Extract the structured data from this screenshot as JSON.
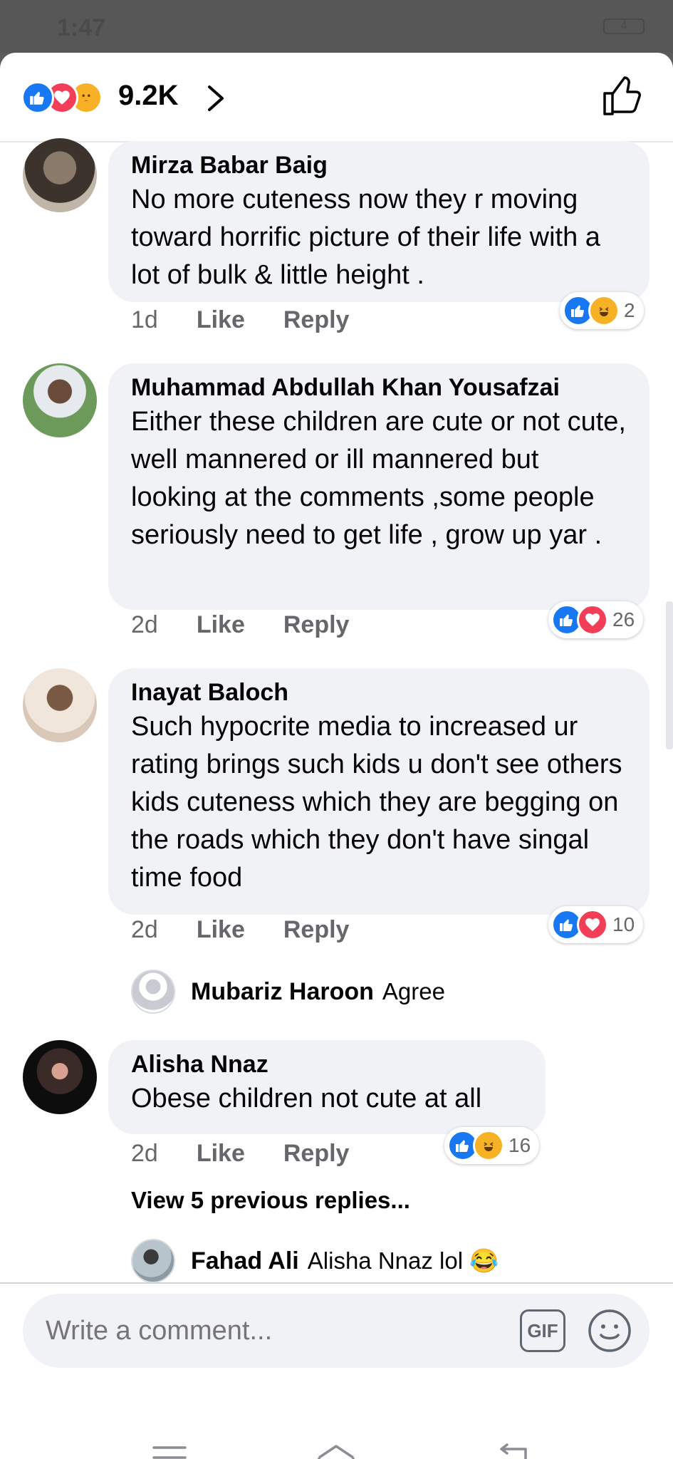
{
  "status_bar": {
    "time": "1:47",
    "battery": "4"
  },
  "header": {
    "reaction_count": "9.2K",
    "reactions": [
      "like-icon",
      "love-icon",
      "care-icon"
    ]
  },
  "comments": [
    {
      "author": "Mirza Babar Baig",
      "text": "No more cuteness now they r moving toward horrific picture of their life with a lot of bulk & little height .",
      "time": "1d",
      "like": "Like",
      "reply": "Reply",
      "reactions": [
        "like-icon",
        "haha-icon"
      ],
      "reaction_count": "2"
    },
    {
      "author": "Muhammad Abdullah Khan Yousafzai",
      "text": "Either these children are cute or not cute, well mannered or ill mannered but looking at the comments ,some people seriously need to get life , grow up yar .",
      "time": "2d",
      "like": "Like",
      "reply": "Reply",
      "reactions": [
        "like-icon",
        "love-icon"
      ],
      "reaction_count": "26"
    },
    {
      "author": "Inayat Baloch",
      "text": "Such hypocrite media to increased ur rating brings such kids u don't see others kids cuteness which they are begging on the roads which they don't have singal time food",
      "time": "2d",
      "like": "Like",
      "reply": "Reply",
      "reactions": [
        "like-icon",
        "love-icon"
      ],
      "reaction_count": "10",
      "reply_preview": {
        "author": "Mubariz Haroon",
        "text": "Agree"
      }
    },
    {
      "author": "Alisha Nnaz",
      "text": "Obese children not cute at all",
      "time": "2d",
      "like": "Like",
      "reply": "Reply",
      "reactions": [
        "like-icon",
        "haha-icon"
      ],
      "reaction_count": "16",
      "view_previous": "View 5 previous replies...",
      "reply_preview": {
        "author": "Fahad Ali",
        "text": "Alisha Nnaz  lol 😂"
      }
    }
  ],
  "composer": {
    "placeholder": "Write a comment...",
    "gif_label": "GIF"
  },
  "colors": {
    "like": "#1877f2",
    "love": "#f33e58",
    "haha": "#f7b125",
    "bubble": "#f0f2f5",
    "secondary_text": "#65676b"
  }
}
